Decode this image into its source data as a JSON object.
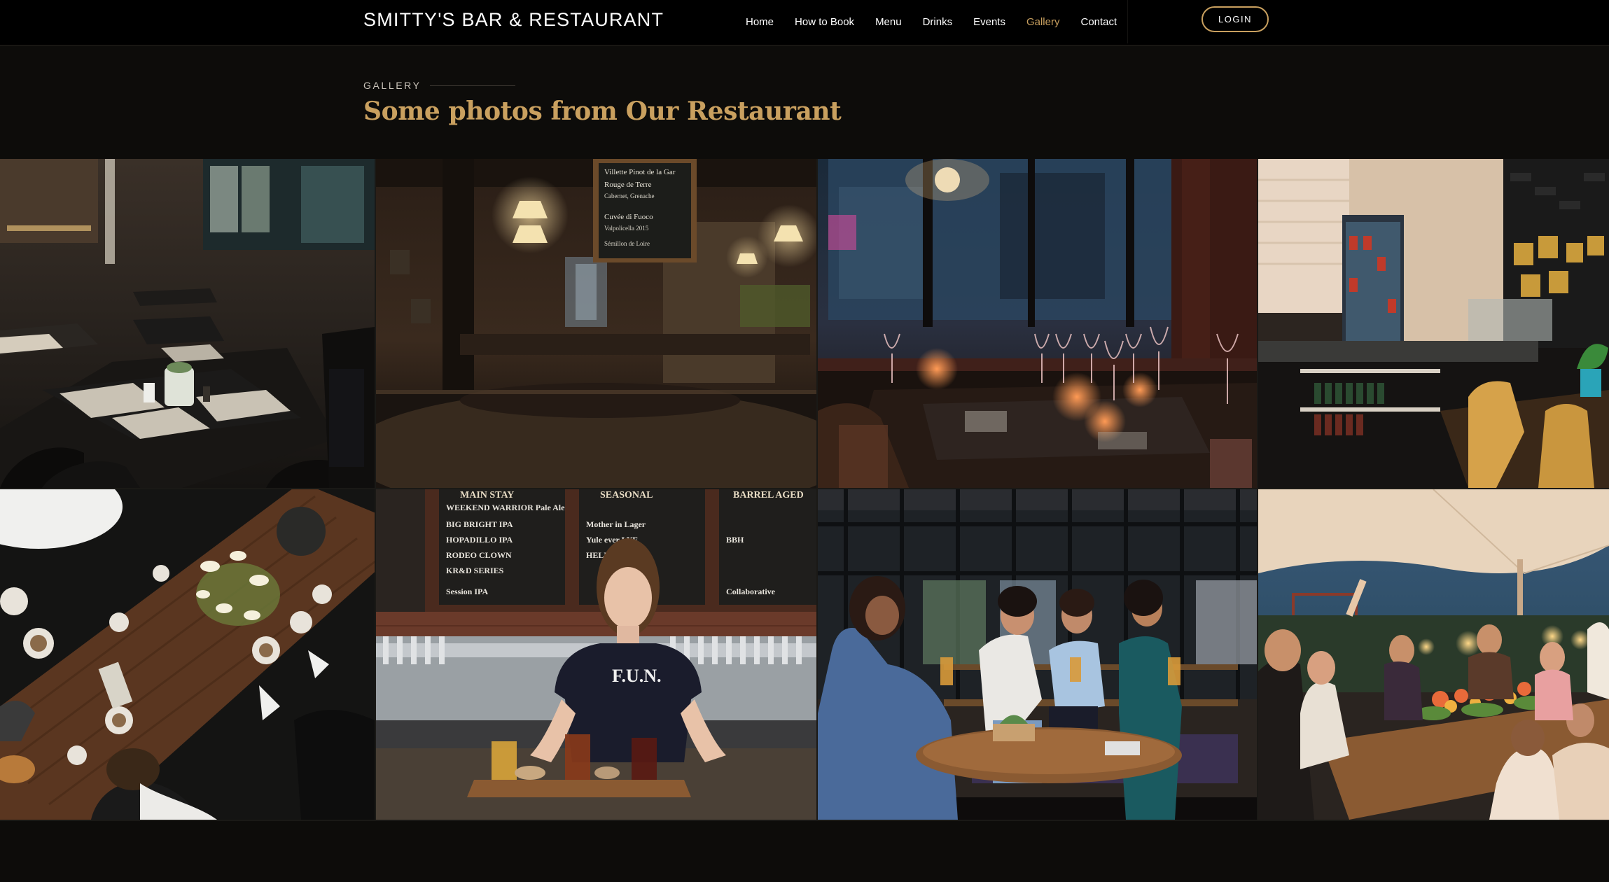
{
  "brand": {
    "name": "SMITTY'S BAR & RESTAURANT"
  },
  "nav": {
    "items": [
      {
        "label": "Home",
        "active": false
      },
      {
        "label": "How to Book",
        "active": false
      },
      {
        "label": "Menu",
        "active": false
      },
      {
        "label": "Drinks",
        "active": false
      },
      {
        "label": "Events",
        "active": false
      },
      {
        "label": "Gallery",
        "active": true
      },
      {
        "label": "Contact",
        "active": false
      }
    ],
    "login_label": "LOGIN"
  },
  "section": {
    "eyebrow": "GALLERY",
    "title": "Some photos from Our Restaurant"
  },
  "colors": {
    "accent": "#c9a05f",
    "background": "#0d0c0a",
    "navbar": "#000000"
  },
  "gallery": {
    "photos": [
      {
        "name": "dining-room-tables-photo"
      },
      {
        "name": "bar-interior-chalkboard-photo",
        "chalkboard_lines": [
          "Villette  Pinot de la Gar",
          "Rouge de Terre",
          "Cabernet, Grenache",
          "Cuvée di Fuoco",
          "Valpolicella 2015",
          "Sémillon de Loire"
        ]
      },
      {
        "name": "window-wine-glasses-photo"
      },
      {
        "name": "cafe-counter-fridge-photo"
      },
      {
        "name": "overhead-wooden-table-photo"
      },
      {
        "name": "bartender-beer-flight-photo",
        "boards": [
          "MAIN STAY",
          "SEASONAL",
          "BARREL AGED"
        ],
        "beers_left": [
          "WEEKEND WARRIOR Pale Ale",
          "BIG BRIGHT IPA",
          "HOPADILLO IPA",
          "RODEO CLOWN",
          "KR&D SERIES",
          "Session IPA"
        ],
        "beers_right": [
          "Mother in Lager",
          "Yule ever LYE",
          "HELL",
          "BBH",
          "Collaborative"
        ],
        "shirt_text": "F.U.N."
      },
      {
        "name": "friends-patio-photo"
      },
      {
        "name": "outdoor-dinner-party-photo"
      }
    ]
  }
}
